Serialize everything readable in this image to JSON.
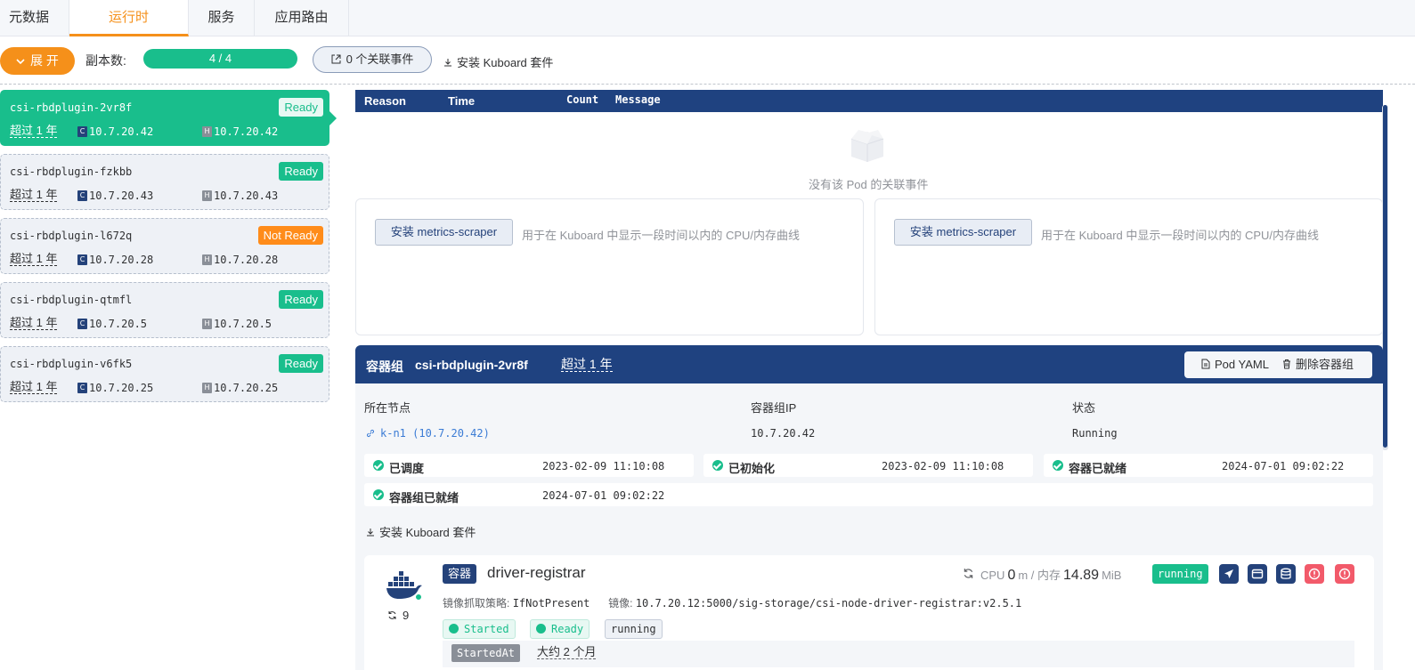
{
  "tabs": [
    {
      "label": "元数据"
    },
    {
      "label": "运行时"
    },
    {
      "label": "服务"
    },
    {
      "label": "应用路由"
    }
  ],
  "toolbar": {
    "expand_label": "展 开",
    "replica_label": "副本数:",
    "replica_value": "4 / 4",
    "events_button": "0 个关联事件",
    "install_link": "安装 Kuboard 套件"
  },
  "pods": [
    {
      "name": "csi-rbdplugin-2vr8f",
      "status": "Ready",
      "age": "超过 1 年",
      "container_ip": "10.7.20.42",
      "host_ip": "10.7.20.42"
    },
    {
      "name": "csi-rbdplugin-fzkbb",
      "status": "Ready",
      "age": "超过 1 年",
      "container_ip": "10.7.20.43",
      "host_ip": "10.7.20.43"
    },
    {
      "name": "csi-rbdplugin-l672q",
      "status": "Not Ready",
      "age": "超过 1 年",
      "container_ip": "10.7.20.28",
      "host_ip": "10.7.20.28"
    },
    {
      "name": "csi-rbdplugin-qtmfl",
      "status": "Ready",
      "age": "超过 1 年",
      "container_ip": "10.7.20.5",
      "host_ip": "10.7.20.5"
    },
    {
      "name": "csi-rbdplugin-v6fk5",
      "status": "Ready",
      "age": "超过 1 年",
      "container_ip": "10.7.20.25",
      "host_ip": "10.7.20.25"
    }
  ],
  "chips": {
    "c": "C",
    "h": "H"
  },
  "events": {
    "columns": [
      "Reason",
      "Time",
      "Count",
      "Message"
    ],
    "empty_text": "没有该 Pod 的关联事件"
  },
  "metrics": [
    {
      "button": "安装 metrics-scraper",
      "description": "用于在 Kuboard 中显示一段时间以内的 CPU/内存曲线"
    },
    {
      "button": "安装 metrics-scraper",
      "description": "用于在 Kuboard 中显示一段时间以内的 CPU/内存曲线"
    }
  ],
  "pod_detail": {
    "title": "容器组",
    "name": "csi-rbdplugin-2vr8f",
    "age": "超过 1 年",
    "yaml_button": "Pod YAML",
    "delete_button": "删除容器组",
    "node_label": "所在节点",
    "node_value": "k-n1 (10.7.20.42)",
    "ip_label": "容器组IP",
    "ip_value": "10.7.20.42",
    "status_label": "状态",
    "status_value": "Running",
    "conditions": [
      {
        "label": "已调度",
        "time": "2023-02-09 11:10:08"
      },
      {
        "label": "已初始化",
        "time": "2023-02-09 11:10:08"
      },
      {
        "label": "容器已就绪",
        "time": "2024-07-01 09:02:22"
      },
      {
        "label": "容器组已就绪",
        "time": "2024-07-01 09:02:22"
      }
    ],
    "install_link": "安装 Kuboard 套件"
  },
  "container": {
    "tag": "容器",
    "name": "driver-registrar",
    "restart_count": "9",
    "cpu_label": "CPU",
    "cpu_value": "0",
    "cpu_unit": "m / 内存",
    "mem_value": "14.89",
    "mem_unit": "MiB",
    "state_badge": "running",
    "pull_policy_label": "镜像抓取策略:",
    "pull_policy_value": "IfNotPresent",
    "image_label": "镜像:",
    "image_value": "10.7.20.12:5000/sig-storage/csi-node-driver-registrar:v2.5.1",
    "tags": [
      "Started",
      "Ready",
      "running"
    ],
    "started_label": "StartedAt",
    "started_value": "大约 2 个月"
  },
  "colors": {
    "accent_orange": "#f5901a",
    "ready_green": "#19be8c",
    "navy": "#1f4280",
    "not_ready_orange": "#ff8c1a",
    "danger_red": "#f25a6a"
  }
}
